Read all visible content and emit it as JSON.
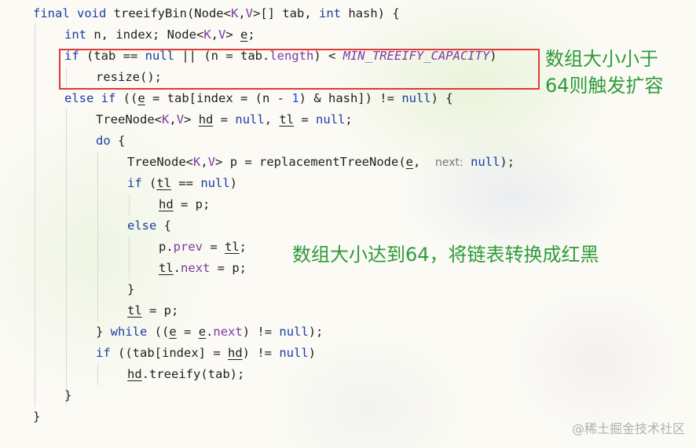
{
  "code": {
    "lines": [
      [
        "final void treeifyBin(Node<K,V>[] tab, int hash) {"
      ],
      [
        "int n, index; Node<K,V> e;"
      ],
      [
        "if (tab == null || (n = tab.length) < MIN_TREEIFY_CAPACITY)"
      ],
      [
        "resize();"
      ],
      [
        "else if ((e = tab[index = (n - 1) & hash]) != null) {"
      ],
      [
        "TreeNode<K,V> hd = null, tl = null;"
      ],
      [
        "do {"
      ],
      [
        "TreeNode<K,V> p = replacementTreeNode(e,",
        "next:",
        "null);"
      ],
      [
        "if (tl == null)"
      ],
      [
        "hd = p;"
      ],
      [
        "else {"
      ],
      [
        "p.prev = tl;"
      ],
      [
        "tl.next = p;"
      ],
      [
        "}"
      ],
      [
        "tl = p;"
      ],
      [
        "} while ((e = e.next) != null);"
      ],
      [
        "if ((tab[index] = hd) != null)"
      ],
      [
        "hd.treeify(tab);"
      ],
      [
        "}"
      ],
      [
        "}"
      ]
    ],
    "param_hint": "next:"
  },
  "annotations": {
    "capacity_line1": "数组大小小于",
    "capacity_line2": "64则触发扩容",
    "treeify_note": "数组大小达到64，将链表转换成红黑"
  },
  "watermark": "@稀土掘金技术社区",
  "colors": {
    "keyword": "#1a3da8",
    "field": "#7b3aa6",
    "annotation": "#2e9b3a",
    "highlight_box": "#e23838"
  }
}
